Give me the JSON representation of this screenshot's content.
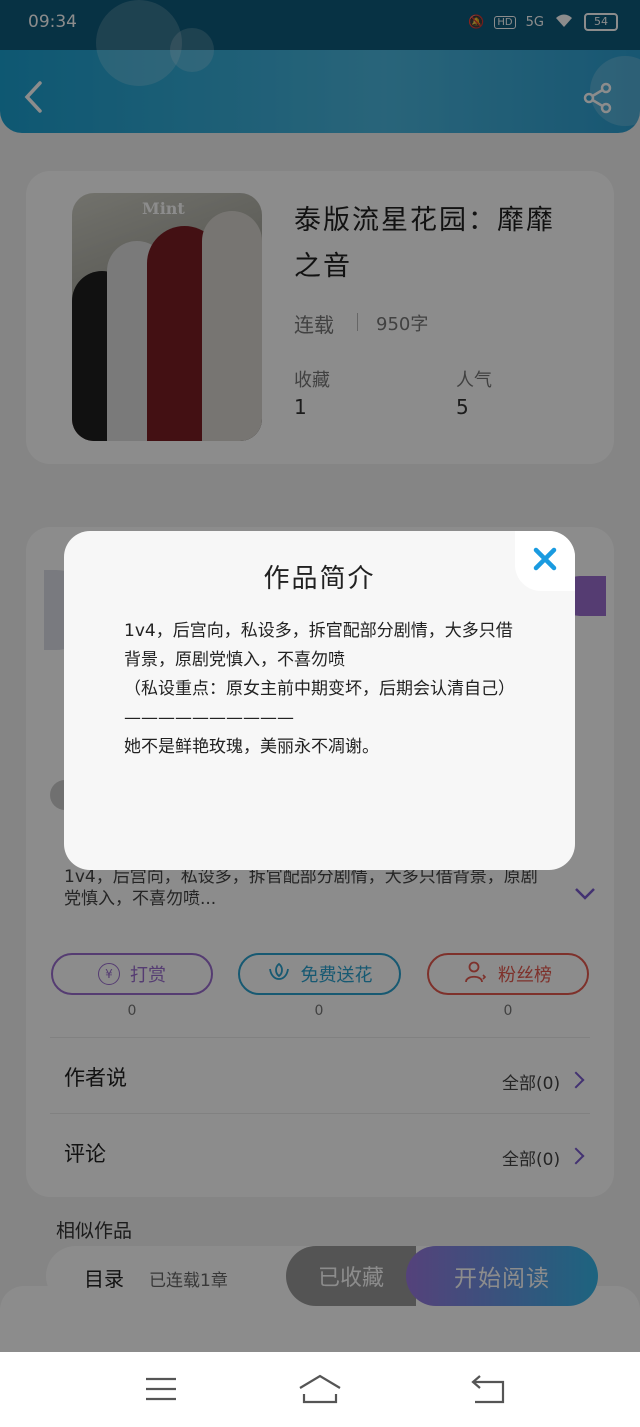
{
  "status_bar": {
    "time": "09:34",
    "network": "5G",
    "battery": "54"
  },
  "book": {
    "title": "泰版流星花园：靡靡之音",
    "cover_text": "Mint",
    "status": "连载",
    "word_count": "950字",
    "stats": [
      {
        "label": "收藏",
        "value": "1"
      },
      {
        "label": "人气",
        "value": "5"
      }
    ]
  },
  "synopsis_preview": "1v4，后宫向，私设多，拆官配部分剧情，大多只借背景，原剧党慎入，不喜勿喷...",
  "actions": [
    {
      "label": "打赏",
      "count": "0",
      "color": "#9b6dd0"
    },
    {
      "label": "免费送花",
      "count": "0",
      "color": "#2aa3cf"
    },
    {
      "label": "粉丝榜",
      "count": "0",
      "color": "#e55a4f"
    }
  ],
  "rows": [
    {
      "label": "作者说",
      "right": "全部(0)"
    },
    {
      "label": "评论",
      "right": "全部(0)"
    }
  ],
  "similar_heading": "相似作品",
  "bottom_bar": {
    "catalog": "目录",
    "progress": "已连载1章",
    "shelved": "已收藏",
    "read": "开始阅读"
  },
  "modal": {
    "title": "作品简介",
    "lines": [
      "1v4，后宫向，私设多，拆官配部分剧情，大多只借背景，原剧党慎入，不喜勿喷",
      "（私设重点：原女主前中期变坏，后期会认清自己）",
      "——————————",
      "她不是鲜艳玫瑰，美丽永不凋谢。"
    ]
  }
}
